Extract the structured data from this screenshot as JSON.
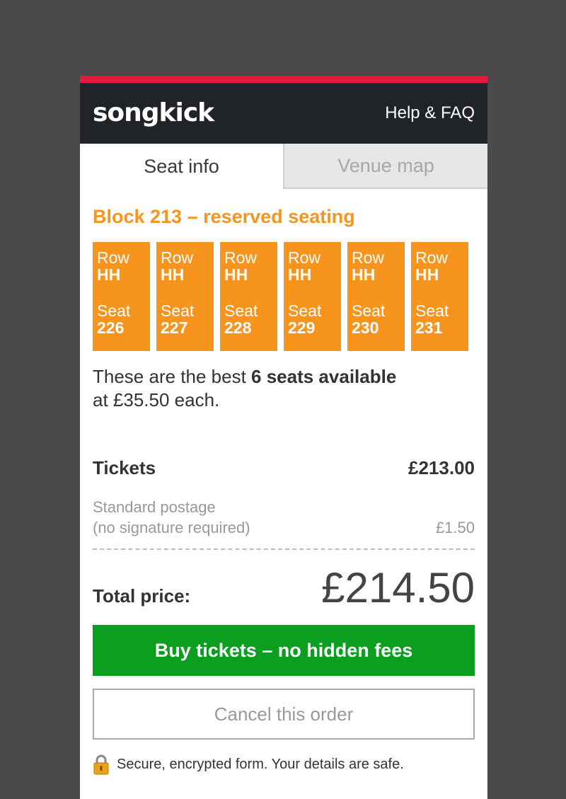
{
  "header": {
    "logo": "songkick",
    "help_link": "Help & FAQ"
  },
  "tabs": [
    {
      "label": "Seat info",
      "active": true
    },
    {
      "label": "Venue map",
      "active": false
    }
  ],
  "block_title": "Block 213 – reserved seating",
  "seat_labels": {
    "row": "Row",
    "seat": "Seat"
  },
  "seats": [
    {
      "row": "HH",
      "seat": "226"
    },
    {
      "row": "HH",
      "seat": "227"
    },
    {
      "row": "HH",
      "seat": "228"
    },
    {
      "row": "HH",
      "seat": "229"
    },
    {
      "row": "HH",
      "seat": "230"
    },
    {
      "row": "HH",
      "seat": "231"
    }
  ],
  "best_text": {
    "prefix": "These are the best ",
    "bold": "6 seats available",
    "suffix": "at £35.50 each."
  },
  "tickets": {
    "label": "Tickets",
    "value": "£213.00"
  },
  "postage": {
    "line1": "Standard postage",
    "line2": "(no signature required)",
    "value": "£1.50"
  },
  "total": {
    "label": "Total price:",
    "value": "£214.50"
  },
  "buy_button": "Buy tickets – no hidden fees",
  "cancel_button": "Cancel this order",
  "secure_text": "Secure, encrypted form. Your details are safe.",
  "colors": {
    "accent": "#e8173c",
    "header_bg": "#202328",
    "seat_orange": "#f7941e",
    "buy_green": "#0c9e1f",
    "page_bg": "#4a4a4a"
  }
}
